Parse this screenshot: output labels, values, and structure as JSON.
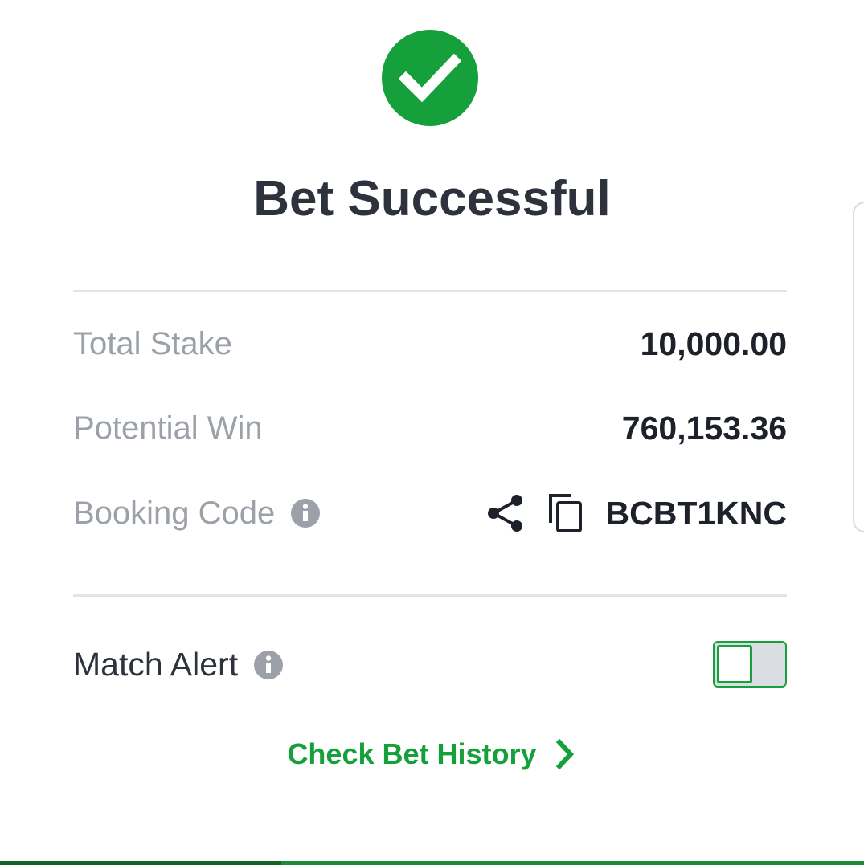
{
  "dialog": {
    "title": "Bet Successful",
    "status_icon": "check-circle-icon"
  },
  "summary": {
    "total_stake": {
      "label": "Total Stake",
      "value": "10,000.00"
    },
    "potential_win": {
      "label": "Potential Win",
      "value": "760,153.36"
    },
    "booking_code": {
      "label": "Booking Code",
      "value": "BCBT1KNC",
      "icons": [
        "info-icon",
        "share-icon",
        "copy-icon"
      ]
    }
  },
  "match_alert": {
    "label": "Match Alert",
    "enabled": false
  },
  "footer": {
    "history_link": "Check Bet History"
  },
  "colors": {
    "accent": "#16a03b",
    "title": "#2d323c",
    "muted": "#9ca1a9",
    "value": "#1d2129"
  }
}
